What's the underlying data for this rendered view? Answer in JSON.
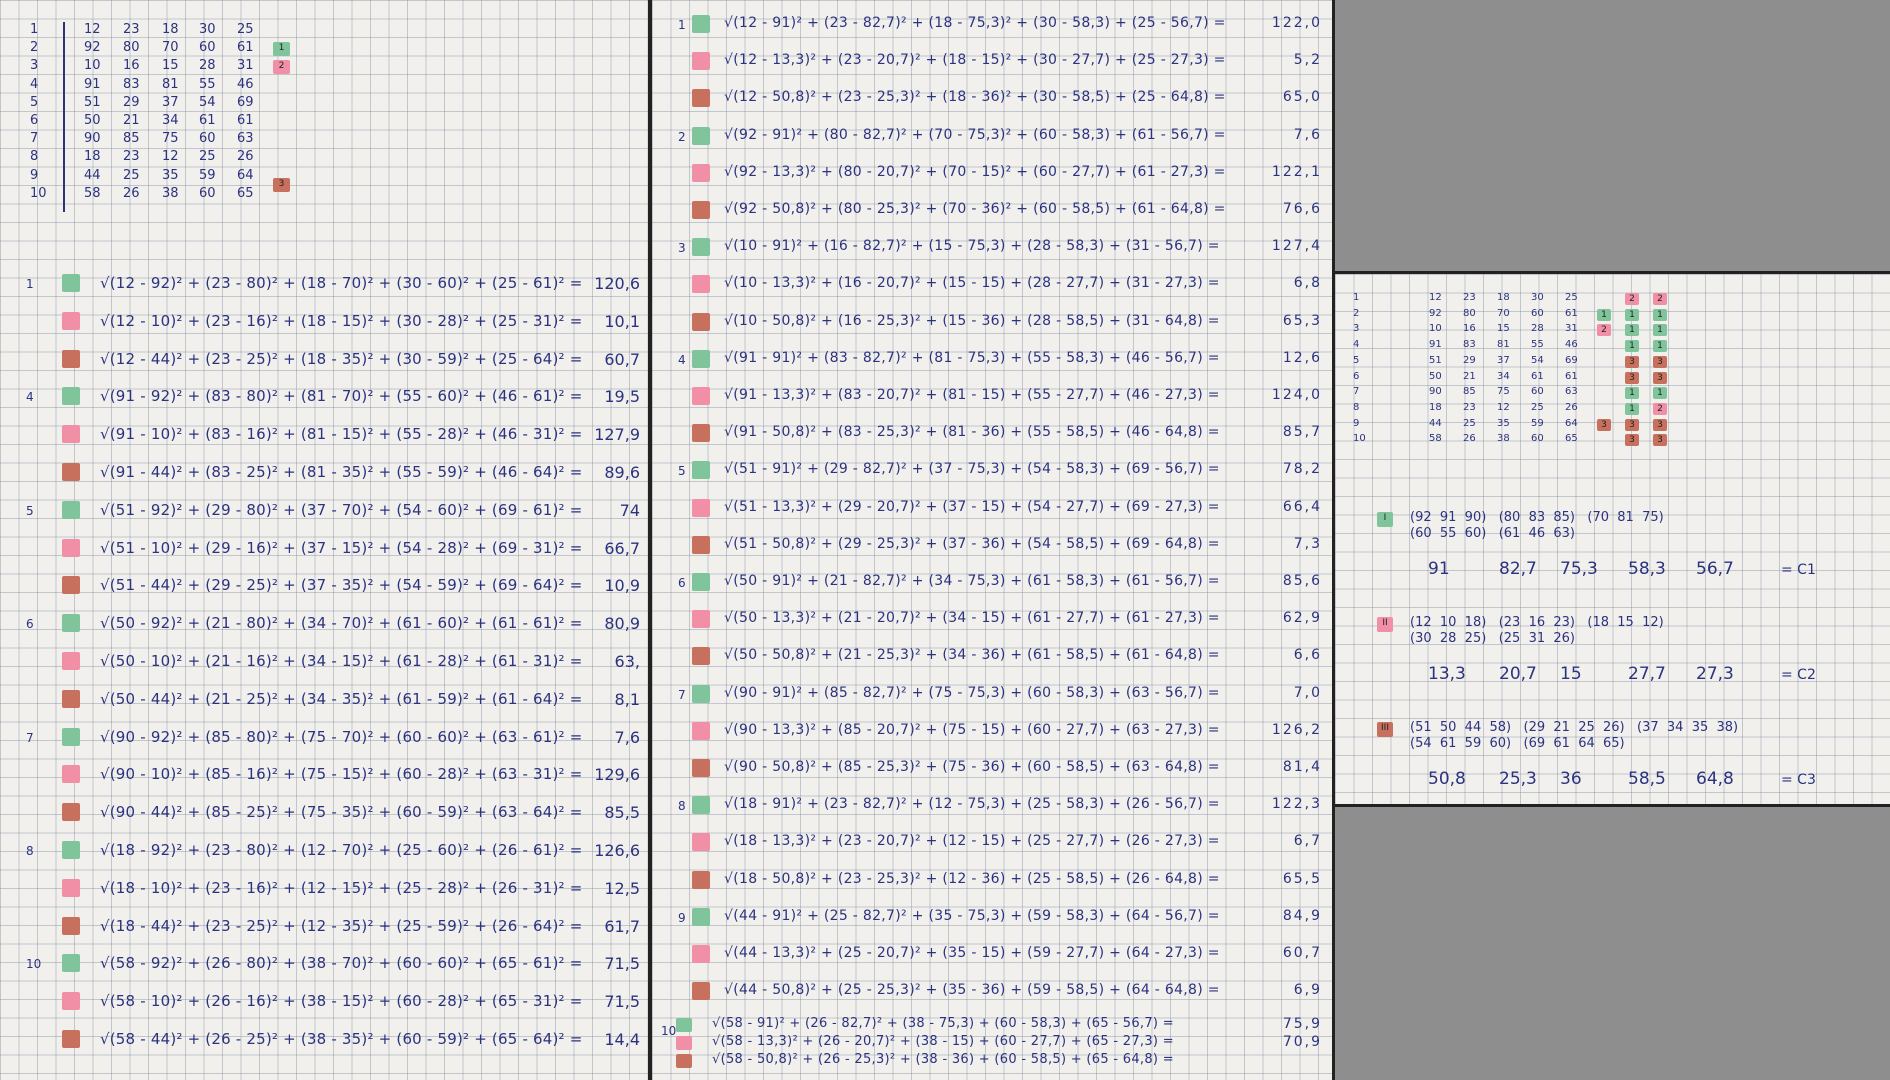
{
  "data_table": [
    [
      "1",
      "12",
      "23",
      "18",
      "30",
      "25"
    ],
    [
      "2",
      "92",
      "80",
      "70",
      "60",
      "61"
    ],
    [
      "3",
      "10",
      "16",
      "15",
      "28",
      "31"
    ],
    [
      "4",
      "91",
      "83",
      "81",
      "55",
      "46"
    ],
    [
      "5",
      "51",
      "29",
      "37",
      "54",
      "69"
    ],
    [
      "6",
      "50",
      "21",
      "34",
      "61",
      "61"
    ],
    [
      "7",
      "90",
      "85",
      "75",
      "60",
      "63"
    ],
    [
      "8",
      "18",
      "23",
      "12",
      "25",
      "26"
    ],
    [
      "9",
      "44",
      "25",
      "35",
      "59",
      "64"
    ],
    [
      "10",
      "58",
      "26",
      "38",
      "60",
      "65"
    ]
  ],
  "initial_tags": {
    "green": "1",
    "pink": "2",
    "brown": "3"
  },
  "sheet1": [
    {
      "n": "1",
      "f": "√(12 - 92)² + (23 - 80)² + (18 - 70)² + (30 - 60)² + (25 - 61)² =",
      "r": "120,6",
      "c": "g"
    },
    {
      "n": "",
      "f": "√(12 - 10)² + (23 - 16)² + (18 - 15)² + (30 - 28)² + (25 - 31)² =",
      "r": "10,1",
      "c": "p"
    },
    {
      "n": "",
      "f": "√(12 - 44)² + (23 - 25)² + (18 - 35)² + (30 - 59)² + (25 - 64)² =",
      "r": "60,7",
      "c": "b"
    },
    {
      "n": "4",
      "f": "√(91 - 92)² + (83 - 80)² + (81 - 70)² + (55 - 60)² + (46 - 61)² =",
      "r": "19,5",
      "c": "g"
    },
    {
      "n": "",
      "f": "√(91 - 10)² + (83 - 16)² + (81 - 15)² + (55 - 28)² + (46 - 31)² =",
      "r": "127,9",
      "c": "p"
    },
    {
      "n": "",
      "f": "√(91 - 44)² + (83 - 25)² + (81 - 35)² + (55 - 59)² + (46 - 64)² =",
      "r": "89,6",
      "c": "b"
    },
    {
      "n": "5",
      "f": "√(51 - 92)² + (29 - 80)² + (37 - 70)² + (54 - 60)² + (69 - 61)² =",
      "r": "74",
      "c": "g"
    },
    {
      "n": "",
      "f": "√(51 - 10)² + (29 - 16)² + (37 - 15)² + (54 - 28)² + (69 - 31)² =",
      "r": "66,7",
      "c": "p"
    },
    {
      "n": "",
      "f": "√(51 - 44)² + (29 - 25)² + (37 - 35)² + (54 - 59)² + (69 - 64)² =",
      "r": "10,9",
      "c": "b"
    },
    {
      "n": "6",
      "f": "√(50 - 92)² + (21 - 80)² + (34 - 70)² + (61 - 60)² + (61 - 61)² =",
      "r": "80,9",
      "c": "g"
    },
    {
      "n": "",
      "f": "√(50 - 10)² + (21 - 16)² + (34 - 15)² + (61 - 28)² + (61 - 31)² =",
      "r": "63,",
      "c": "p"
    },
    {
      "n": "",
      "f": "√(50 - 44)² + (21 - 25)² + (34 - 35)² + (61 - 59)² + (61 - 64)² =",
      "r": "8,1",
      "c": "b"
    },
    {
      "n": "7",
      "f": "√(90 - 92)² + (85 - 80)² + (75 - 70)² + (60 - 60)² + (63 - 61)² =",
      "r": "7,6",
      "c": "g"
    },
    {
      "n": "",
      "f": "√(90 - 10)² + (85 - 16)² + (75 - 15)² + (60 - 28)² + (63 - 31)² =",
      "r": "129,6",
      "c": "p"
    },
    {
      "n": "",
      "f": "√(90 - 44)² + (85 - 25)² + (75 - 35)² + (60 - 59)² + (63 - 64)² =",
      "r": "85,5",
      "c": "b"
    },
    {
      "n": "8",
      "f": "√(18 - 92)² + (23 - 80)² + (12 - 70)² + (25 - 60)² + (26 - 61)² =",
      "r": "126,6",
      "c": "g"
    },
    {
      "n": "",
      "f": "√(18 - 10)² + (23 - 16)² + (12 - 15)² + (25 - 28)² + (26 - 31)² =",
      "r": "12,5",
      "c": "p"
    },
    {
      "n": "",
      "f": "√(18 - 44)² + (23 - 25)² + (12 - 35)² + (25 - 59)² + (26 - 64)² =",
      "r": "61,7",
      "c": "b"
    },
    {
      "n": "10",
      "f": "√(58 - 92)² + (26 - 80)² + (38 - 70)² + (60 - 60)² + (65 - 61)² =",
      "r": "71,5",
      "c": "g"
    },
    {
      "n": "",
      "f": "√(58 - 10)² + (26 - 16)² + (38 - 15)² + (60 - 28)² + (65 - 31)² =",
      "r": "71,5",
      "c": "p"
    },
    {
      "n": "",
      "f": "√(58 - 44)² + (26 - 25)² + (38 - 35)² + (60 - 59)² + (65 - 64)² =",
      "r": "14,4",
      "c": "b"
    }
  ],
  "sheet2": [
    {
      "n": "1",
      "f": "√(12 - 91)² + (23 - 82,7)² + (18 - 75,3)² + (30 - 58,3) + (25 - 56,7) =",
      "r": "122,0",
      "c": "g"
    },
    {
      "n": "",
      "f": "√(12 - 13,3)² + (23 - 20,7)² + (18 - 15)² + (30 - 27,7) + (25 - 27,3) =",
      "r": "5,2",
      "c": "p"
    },
    {
      "n": "",
      "f": "√(12 - 50,8)² + (23 - 25,3)² + (18 - 36)² + (30 - 58,5) + (25 - 64,8) =",
      "r": "65,0",
      "c": "b"
    },
    {
      "n": "2",
      "f": "√(92 - 91)² + (80 - 82,7)² + (70 - 75,3)² + (60 - 58,3) + (61 - 56,7) =",
      "r": "7,6",
      "c": "g"
    },
    {
      "n": "",
      "f": "√(92 - 13,3)² + (80 - 20,7)² + (70 - 15)² + (60 - 27,7) + (61 - 27,3) =",
      "r": "122,1",
      "c": "p"
    },
    {
      "n": "",
      "f": "√(92 - 50,8)² + (80 - 25,3)² + (70 - 36)² + (60 - 58,5) + (61 - 64,8) =",
      "r": "76,6",
      "c": "b"
    },
    {
      "n": "3",
      "f": "√(10 - 91)² + (16 - 82,7)² + (15 - 75,3) + (28 - 58,3) + (31 - 56,7) =",
      "r": "127,4",
      "c": "g"
    },
    {
      "n": "",
      "f": "√(10 - 13,3)² + (16 - 20,7)² + (15 - 15) + (28 - 27,7) + (31 - 27,3) =",
      "r": "6,8",
      "c": "p"
    },
    {
      "n": "",
      "f": "√(10 - 50,8)² + (16 - 25,3)² + (15 - 36) + (28 - 58,5) + (31 - 64,8) =",
      "r": "65,3",
      "c": "b"
    },
    {
      "n": "4",
      "f": "√(91 - 91)² + (83 - 82,7)² + (81 - 75,3) + (55 - 58,3) + (46 - 56,7) =",
      "r": "12,6",
      "c": "g"
    },
    {
      "n": "",
      "f": "√(91 - 13,3)² + (83 - 20,7)² + (81 - 15) + (55 - 27,7) + (46 - 27,3) =",
      "r": "124,0",
      "c": "p"
    },
    {
      "n": "",
      "f": "√(91 - 50,8)² + (83 - 25,3)² + (81 - 36) + (55 - 58,5) + (46 - 64,8) =",
      "r": "85,7",
      "c": "b"
    },
    {
      "n": "5",
      "f": "√(51 - 91)² + (29 - 82,7)² + (37 - 75,3) + (54 - 58,3) + (69 - 56,7) =",
      "r": "78,2",
      "c": "g"
    },
    {
      "n": "",
      "f": "√(51 - 13,3)² + (29 - 20,7)² + (37 - 15) + (54 - 27,7) + (69 - 27,3) =",
      "r": "66,4",
      "c": "p"
    },
    {
      "n": "",
      "f": "√(51 - 50,8)² + (29 - 25,3)² + (37 - 36) + (54 - 58,5) + (69 - 64,8) =",
      "r": "7,3",
      "c": "b"
    },
    {
      "n": "6",
      "f": "√(50 - 91)² + (21 - 82,7)² + (34 - 75,3) + (61 - 58,3) + (61 - 56,7) =",
      "r": "85,6",
      "c": "g"
    },
    {
      "n": "",
      "f": "√(50 - 13,3)² + (21 - 20,7)² + (34 - 15) + (61 - 27,7) + (61 - 27,3) =",
      "r": "62,9",
      "c": "p"
    },
    {
      "n": "",
      "f": "√(50 - 50,8)² + (21 - 25,3)² + (34 - 36) + (61 - 58,5) + (61 - 64,8) =",
      "r": "6,6",
      "c": "b"
    },
    {
      "n": "7",
      "f": "√(90 - 91)² + (85 - 82,7)² + (75 - 75,3) + (60 - 58,3) + (63 - 56,7) =",
      "r": "7,0",
      "c": "g"
    },
    {
      "n": "",
      "f": "√(90 - 13,3)² + (85 - 20,7)² + (75 - 15) + (60 - 27,7) + (63 - 27,3) =",
      "r": "126,2",
      "c": "p"
    },
    {
      "n": "",
      "f": "√(90 - 50,8)² + (85 - 25,3)² + (75 - 36) + (60 - 58,5) + (63 - 64,8) =",
      "r": "81,4",
      "c": "b"
    },
    {
      "n": "8",
      "f": "√(18 - 91)² + (23 - 82,7)² + (12 - 75,3) + (25 - 58,3) + (26 - 56,7) =",
      "r": "122,3",
      "c": "g"
    },
    {
      "n": "",
      "f": "√(18 - 13,3)² + (23 - 20,7)² + (12 - 15) + (25 - 27,7) + (26 - 27,3) =",
      "r": "6,7",
      "c": "p"
    },
    {
      "n": "",
      "f": "√(18 - 50,8)² + (23 - 25,3)² + (12 - 36) + (25 - 58,5) + (26 - 64,8) =",
      "r": "65,5",
      "c": "b"
    },
    {
      "n": "9",
      "f": "√(44 - 91)² + (25 - 82,7)² + (35 - 75,3) + (59 - 58,3) + (64 - 56,7) =",
      "r": "84,9",
      "c": "g"
    },
    {
      "n": "",
      "f": "√(44 - 13,3)² + (25 - 20,7)² + (35 - 15) + (59 - 27,7) + (64 - 27,3) =",
      "r": "60,7",
      "c": "p"
    },
    {
      "n": "",
      "f": "√(44 - 50,8)² + (25 - 25,3)² + (35 - 36) + (59 - 58,5) + (64 - 64,8) =",
      "r": "6,9",
      "c": "b"
    }
  ],
  "sheet2_last": [
    {
      "f": "√(58 - 91)² + (26 - 82,7)² + (38 - 75,3) + (60 - 58,3) + (65 - 56,7) =",
      "r": "75,9",
      "c": "g"
    },
    {
      "f": "√(58 - 13,3)² + (26 - 20,7)² + (38 - 15) + (60 - 27,7) + (65 - 27,3) =",
      "r": "70,9",
      "c": "p"
    },
    {
      "f": "√(58 - 50,8)² + (26 - 25,3)² + (38 - 36) + (60 - 58,5) + (65 - 64,8) =",
      "r": "",
      "c": "b"
    }
  ],
  "sheet2_last_n": "10",
  "sheet3_tags": [
    [
      "",
      "2",
      "2"
    ],
    [
      "1",
      "1",
      "1"
    ],
    [
      "2",
      "1",
      "1"
    ],
    [
      "",
      "1",
      "1"
    ],
    [
      "",
      "3",
      "3"
    ],
    [
      "",
      "3",
      "3"
    ],
    [
      "",
      "1",
      "1"
    ],
    [
      "",
      "1",
      "2"
    ],
    [
      "3",
      "3",
      "3"
    ],
    [
      "",
      "3",
      "3"
    ]
  ],
  "sheet3_tag_colors": [
    [
      "",
      "p",
      "p"
    ],
    [
      "g",
      "g",
      "g"
    ],
    [
      "p",
      "g",
      "g"
    ],
    [
      "",
      "g",
      "g"
    ],
    [
      "",
      "b",
      "b"
    ],
    [
      "",
      "b",
      "b"
    ],
    [
      "",
      "g",
      "g"
    ],
    [
      "",
      "g",
      "p"
    ],
    [
      "b",
      "b",
      "b"
    ],
    [
      "",
      "b",
      "b"
    ]
  ],
  "clusters": [
    {
      "label": "I",
      "color": "g",
      "row1": "(92  91  90)   (80  83  85)   (70  81  75)",
      "row2": "(60  55  60)   (61  46  63)",
      "means": [
        "91",
        "82,7",
        "75,3",
        "58,3",
        "56,7"
      ],
      "name": "= C1"
    },
    {
      "label": "II",
      "color": "p",
      "row1": "(12  10  18)   (23  16  23)   (18  15  12)",
      "row2": "(30  28  25)   (25  31  26)",
      "means": [
        "13,3",
        "20,7",
        "15",
        "27,7",
        "27,3"
      ],
      "name": "= C2"
    },
    {
      "label": "III",
      "color": "b",
      "row1": "(51  50  44  58)   (29  21  25  26)   (37  34  35  38)",
      "row2": "(54  61  59  60)   (69  61  64  65)",
      "means": [
        "50,8",
        "25,3",
        "36",
        "58,5",
        "64,8"
      ],
      "name": "= C3"
    }
  ]
}
